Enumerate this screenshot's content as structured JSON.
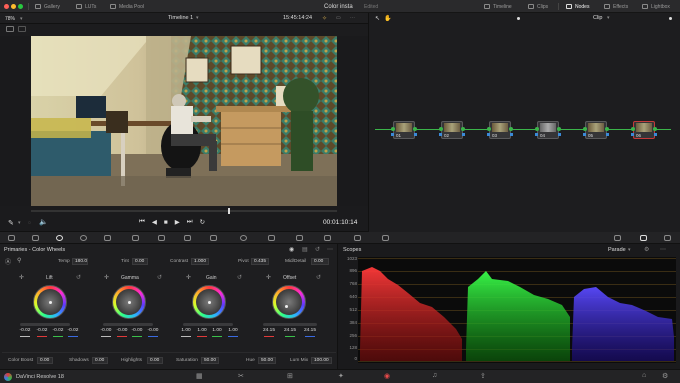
{
  "topbar": {
    "gallery": "Gallery",
    "luts": "LUTs",
    "media_pool": "Media Pool",
    "project_title": "Color insta",
    "project_status": "Edited",
    "timeline": "Timeline",
    "clips": "Clips",
    "nodes": "Nodes",
    "effects": "Effects",
    "lightbox": "Lightbox"
  },
  "viewer": {
    "zoom": "78%",
    "timeline_name": "Timeline 1",
    "timecode_top": "15:45:14:24",
    "timecode_bottom": "00:01:10:14"
  },
  "node_editor": {
    "mode": "Clip",
    "nodes": [
      "01",
      "02",
      "03",
      "04",
      "05",
      "06"
    ]
  },
  "primaries": {
    "title": "Primaries - Color Wheels",
    "temp_label": "Temp",
    "temp_value": "180.0",
    "tint_label": "Tint",
    "tint_value": "0.00",
    "contrast_label": "Contrast",
    "contrast_value": "1.000",
    "pivot_label": "Pivot",
    "pivot_value": "0.435",
    "middetail_label": "Mid/Detail",
    "middetail_value": "0.00",
    "wheels": [
      {
        "name": "Lift",
        "values": [
          "-0.02",
          "-0.02",
          "-0.02",
          "-0.02"
        ]
      },
      {
        "name": "Gamma",
        "values": [
          "-0.00",
          "-0.00",
          "-0.00",
          "-0.00"
        ]
      },
      {
        "name": "Gain",
        "values": [
          "1.00",
          "1.00",
          "1.00",
          "1.00"
        ]
      },
      {
        "name": "Offset",
        "values": [
          "24.15",
          "24.15",
          "24.15"
        ]
      }
    ],
    "color_boost_label": "Color Boost",
    "color_boost_value": "0.00",
    "shadows_label": "Shadows",
    "shadows_value": "0.00",
    "highlights_label": "Highlights",
    "highlights_value": "0.00",
    "saturation_label": "Saturation",
    "saturation_value": "50.00",
    "hue_label": "Hue",
    "hue_value": "50.00",
    "lummix_label": "Lum Mix",
    "lummix_value": "100.00"
  },
  "scopes": {
    "title": "Scopes",
    "mode": "Parade",
    "ticks": [
      "1023",
      "896",
      "768",
      "640",
      "512",
      "384",
      "256",
      "128",
      "0"
    ],
    "colors": {
      "red": "#ff2a2a",
      "green": "#2aff2a",
      "blue": "#3a3aff"
    }
  },
  "bottombar": {
    "app_name": "DaVinci Resolve 18"
  }
}
